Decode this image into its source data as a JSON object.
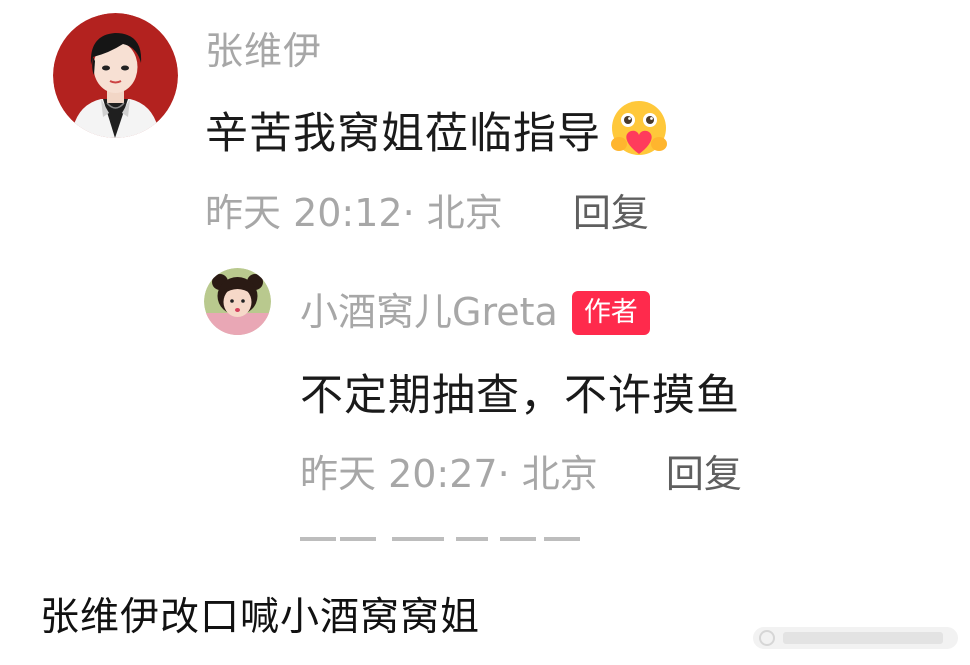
{
  "comment": {
    "username": "张维伊",
    "content": "辛苦我窝姐莅临指导",
    "emoji": "hugging-face-heart-emoji",
    "time": "昨天 20:12·",
    "location": "北京",
    "reply_label": "回复"
  },
  "reply": {
    "username": "小酒窝儿Greta",
    "badge": "作者",
    "content": "不定期抽查，不许摸鱼",
    "time": "昨天 20:27·",
    "location": "北京",
    "reply_label": "回复"
  },
  "caption": "张维伊改口喊小酒窝窝姐",
  "colors": {
    "badge": "#ff2a4c",
    "meta_text": "#a7a7a7",
    "body_text": "#1a1a1a"
  }
}
